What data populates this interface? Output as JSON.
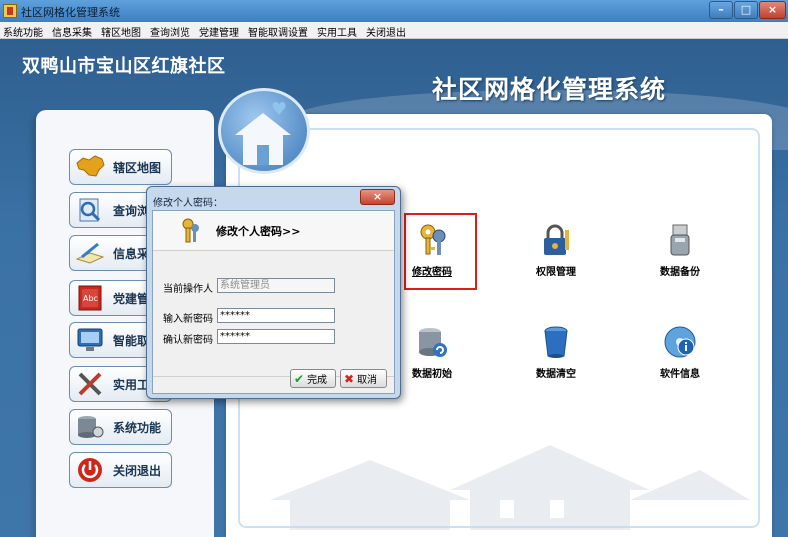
{
  "window": {
    "title": "社区网格化管理系统",
    "min": "–",
    "max": "□",
    "close": "×"
  },
  "menu": [
    "系统功能",
    "信息采集",
    "辖区地图",
    "查询浏览",
    "党建管理",
    "智能取调设置",
    "实用工具",
    "关闭退出"
  ],
  "header": {
    "community": "双鸭山市宝山区红旗社区",
    "system_title": "社区网格化管理系统"
  },
  "nav": [
    {
      "label": "辖区地图",
      "icon": "china-map-icon"
    },
    {
      "label": "查询浏览",
      "icon": "search-document-icon"
    },
    {
      "label": "信息采集",
      "icon": "pen-paper-icon"
    },
    {
      "label": "党建管理",
      "icon": "abc-book-icon"
    },
    {
      "label": "智能取调",
      "icon": "monitor-icon"
    },
    {
      "label": "实用工具",
      "icon": "tools-icon"
    },
    {
      "label": "系统功能",
      "icon": "database-gear-icon"
    },
    {
      "label": "关闭退出",
      "icon": "power-icon"
    }
  ],
  "functions": [
    {
      "label": "修改密码",
      "icon": "key-icon",
      "selected": true
    },
    {
      "label": "权限管理",
      "icon": "lock-key-icon"
    },
    {
      "label": "数据备份",
      "icon": "usb-drive-icon"
    },
    {
      "label": "数据初始",
      "icon": "database-refresh-icon"
    },
    {
      "label": "数据清空",
      "icon": "trash-icon"
    },
    {
      "label": "软件信息",
      "icon": "info-disc-icon"
    }
  ],
  "dialog": {
    "title": "修改个人密码：",
    "header": "修改个人密码>>",
    "close": "×",
    "operator_label": "当前操作人",
    "operator_value": "系统管理员",
    "new_password_label": "输入新密码",
    "new_password_value": "******",
    "confirm_password_label": "确认新密码",
    "confirm_password_value": "******",
    "ok_label": "完成",
    "cancel_label": "取消"
  },
  "colors": {
    "highlight": "#e21b1b",
    "banner": "#3b72a6",
    "accent": "#2c6aa8"
  }
}
